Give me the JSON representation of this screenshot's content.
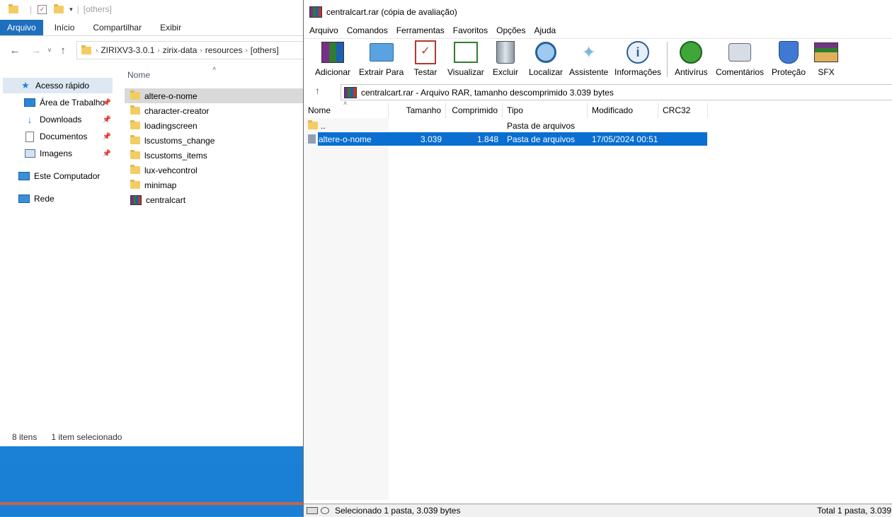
{
  "explorer": {
    "qat_path": "[others]",
    "ribbon_tabs": [
      "Arquivo",
      "Início",
      "Compartilhar",
      "Exibir"
    ],
    "breadcrumb": [
      "ZIRIXV3-3.0.1",
      "zirix-data",
      "resources",
      "[others]"
    ],
    "nav": {
      "quick_access": "Acesso rápido",
      "pinned": [
        "Área de Trabalho",
        "Downloads",
        "Documentos",
        "Imagens"
      ],
      "this_pc": "Este Computador",
      "network": "Rede"
    },
    "column_name": "Nome",
    "files": [
      "altere-o-nome",
      "character-creator",
      "loadingscreen",
      "lscustoms_change",
      "lscustoms_items",
      "lux-vehcontrol",
      "minimap",
      "centralcart"
    ],
    "status_count": "8 itens",
    "status_selected": "1 item selecionado"
  },
  "winrar": {
    "title": "centralcart.rar (cópia de avaliação)",
    "menu": [
      "Arquivo",
      "Comandos",
      "Ferramentas",
      "Favoritos",
      "Opções",
      "Ajuda"
    ],
    "toolbar": [
      "Adicionar",
      "Extrair Para",
      "Testar",
      "Visualizar",
      "Excluir",
      "Localizar",
      "Assistente",
      "Informações",
      "Antivírus",
      "Comentários",
      "Proteção",
      "SFX"
    ],
    "path_info": "centralcart.rar - Arquivo RAR, tamanho descomprimido 3.039 bytes",
    "columns": [
      "Nome",
      "Tamanho",
      "Comprimido",
      "Tipo",
      "Modificado",
      "CRC32"
    ],
    "rows": [
      {
        "name": "..",
        "size": "",
        "packed": "",
        "type": "Pasta de arquivos",
        "modified": "",
        "crc": ""
      },
      {
        "name": "altere-o-nome",
        "size": "3.039",
        "packed": "1.848",
        "type": "Pasta de arquivos",
        "modified": "17/05/2024 00:51",
        "crc": ""
      }
    ],
    "status_left": "Selecionado 1 pasta, 3.039 bytes",
    "status_right": "Total 1 pasta, 3.039"
  },
  "colors": {
    "accent": "#1f6fbf",
    "selection": "#0a6fd1",
    "desktop": "#1a7fd4"
  }
}
